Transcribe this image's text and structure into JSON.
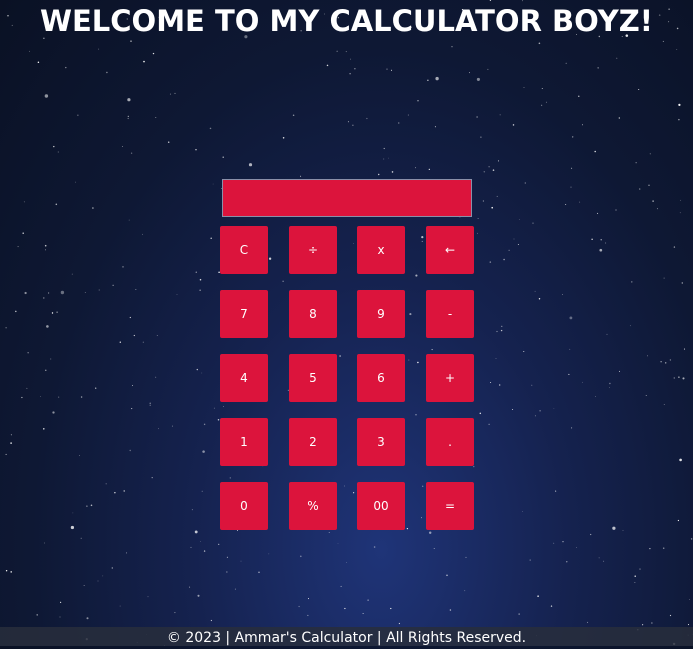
{
  "header": {
    "title": "WELCOME TO MY CALCULATOR BOYZ!"
  },
  "calculator": {
    "display_value": "",
    "keys": [
      [
        {
          "label": "C",
          "name": "clear-button"
        },
        {
          "label": "÷",
          "name": "divide-button"
        },
        {
          "label": "x",
          "name": "multiply-button"
        },
        {
          "label": "←",
          "name": "backspace-button"
        }
      ],
      [
        {
          "label": "7",
          "name": "digit-7-button"
        },
        {
          "label": "8",
          "name": "digit-8-button"
        },
        {
          "label": "9",
          "name": "digit-9-button"
        },
        {
          "label": "-",
          "name": "subtract-button"
        }
      ],
      [
        {
          "label": "4",
          "name": "digit-4-button"
        },
        {
          "label": "5",
          "name": "digit-5-button"
        },
        {
          "label": "6",
          "name": "digit-6-button"
        },
        {
          "label": "+",
          "name": "add-button"
        }
      ],
      [
        {
          "label": "1",
          "name": "digit-1-button"
        },
        {
          "label": "2",
          "name": "digit-2-button"
        },
        {
          "label": "3",
          "name": "digit-3-button"
        },
        {
          "label": ".",
          "name": "decimal-point-button"
        }
      ],
      [
        {
          "label": "0",
          "name": "digit-0-button"
        },
        {
          "label": "%",
          "name": "percent-button"
        },
        {
          "label": "00",
          "name": "double-zero-button"
        },
        {
          "label": "=",
          "name": "equals-button"
        }
      ]
    ]
  },
  "footer": {
    "text": "© 2023 | Ammar's Calculator | All Rights Reserved."
  },
  "colors": {
    "button_background": "#dc143c",
    "display_background": "#dc143c",
    "text": "#ffffff",
    "page_background": "#0e1834"
  }
}
